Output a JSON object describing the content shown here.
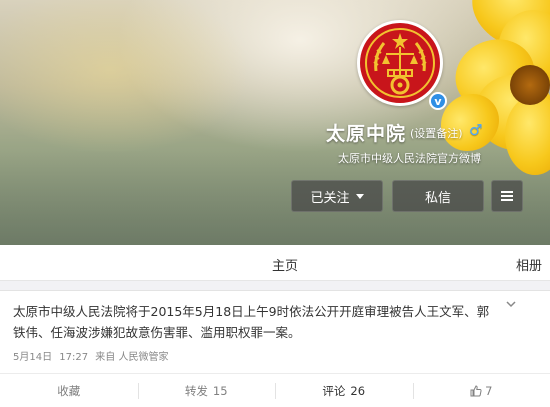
{
  "profile": {
    "name": "太原中院",
    "remark": "(设置备注)",
    "gender_icon": "male-icon",
    "description": "太原市中级人民法院官方微博",
    "verified_icon": "verified-v-icon"
  },
  "buttons": {
    "follow": "已关注",
    "message": "私信",
    "more_icon": "menu-icon"
  },
  "tabs": {
    "home": "主页",
    "album": "相册"
  },
  "post": {
    "text": "太原市中级人民法院将于2015年5月18日上午9时依法公开开庭审理被告人王文军、郭铁伟、任海波涉嫌犯故意伤害罪、滥用职权罪一案。",
    "date": "5月14日",
    "time": "17:27",
    "source": "来自 人民微管家",
    "actions": {
      "favorite_label": "收藏",
      "repost_label": "转发",
      "repost_count": "15",
      "comment_label": "评论",
      "comment_count": "26",
      "like_count": "7"
    }
  },
  "colors": {
    "accent_blue": "#2f8fe5",
    "emblem_red": "#c8151b",
    "emblem_gold": "#f2c230"
  }
}
